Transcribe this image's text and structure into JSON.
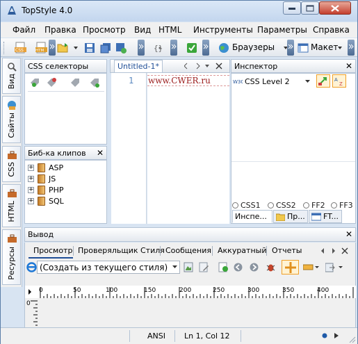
{
  "window": {
    "title": "TopStyle 4.0"
  },
  "menu": [
    "Файл",
    "Правка",
    "Просмотр",
    "Вид",
    "HTML",
    "Инструменты",
    "Параметры",
    "Справка"
  ],
  "toolbar": {
    "browsers_label": "Браузеры",
    "layout_label": "Макет"
  },
  "sidetabs": [
    "Вид",
    "Сайты",
    "CSS",
    "HTML",
    "Ресурсы"
  ],
  "css_panel": {
    "title": "CSS селекторы"
  },
  "clips_panel": {
    "title": "Биб-ка клипов",
    "items": [
      "ASP",
      "JS",
      "PHP",
      "SQL"
    ]
  },
  "editor": {
    "tab_label": "Untitled-1*",
    "line_number": "1",
    "code": "www.CWER.ru"
  },
  "inspector": {
    "title": "Инспектор",
    "level": "CSS Level 2",
    "radios": [
      "CSS1",
      "CSS2",
      "FF2",
      "FF3"
    ],
    "tabs": [
      "Инспе...",
      "Пр...",
      "FT..."
    ]
  },
  "output": {
    "title": "Вывод",
    "tabs": [
      "Просмотр",
      "Проверяльщик Стиля",
      "Сообщения",
      "Аккуратный",
      "Отчеты"
    ],
    "style_source": "(Создать из текущего стиля)"
  },
  "ruler": {
    "ticks": [
      "0",
      "50",
      "100",
      "150",
      "200",
      "250",
      "300",
      "350",
      "400"
    ],
    "vticks": [
      "0"
    ]
  },
  "status": {
    "encoding": "ANSI",
    "position": "Ln 1, Col 12"
  },
  "colors": {
    "accent": "#1f4e96",
    "code_text": "#9b1a1a",
    "border": "#b4c3d5"
  }
}
